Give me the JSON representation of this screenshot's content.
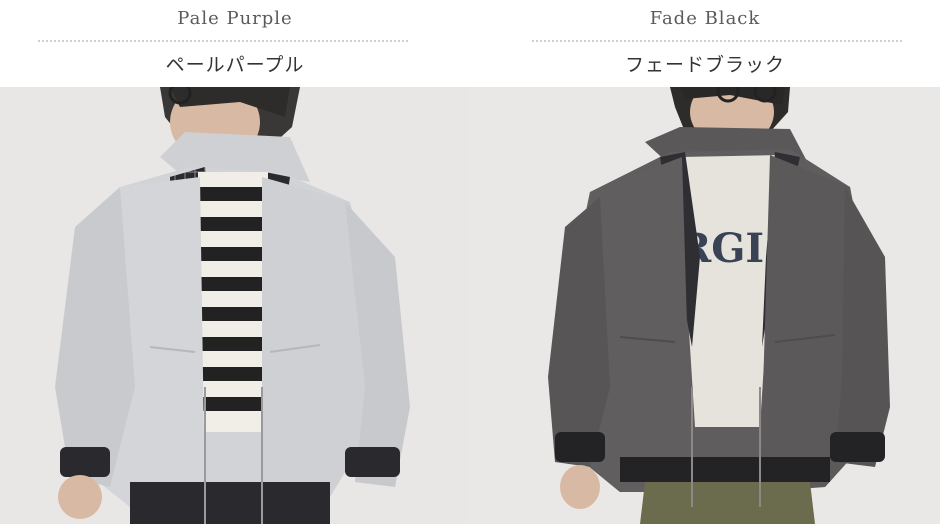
{
  "products": [
    {
      "name_en": "Pale Purple",
      "name_jp": "ペールパープル",
      "photo": "model-wearing-pale-purple-hooded-jacket"
    },
    {
      "name_en": "Fade Black",
      "name_jp": "フェードブラック",
      "photo": "model-wearing-fade-black-hooded-jacket"
    }
  ],
  "colors": {
    "background": "#ffffff",
    "photo_backdrop": "#e8e7e5",
    "pale_purple_jacket": "#d2d3d6",
    "fade_black_jacket": "#5f5d5d",
    "divider": "#cfcfcf",
    "label_en": "#5a5a5a",
    "label_jp": "#333333"
  }
}
